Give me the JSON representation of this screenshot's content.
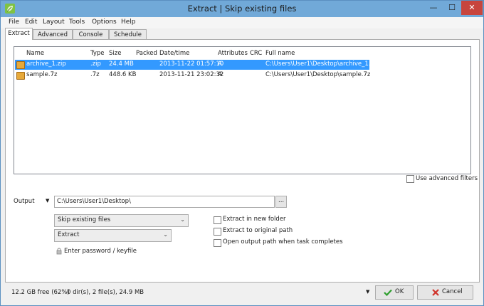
{
  "window": {
    "title": "Extract | Skip existing files",
    "min_glyph": "—",
    "max_glyph": "☐",
    "close_glyph": "✕"
  },
  "menu": [
    "File",
    "Edit",
    "Layout",
    "Tools",
    "Options",
    "Help"
  ],
  "tabs": [
    "Extract",
    "Advanced",
    "Console",
    "Schedule"
  ],
  "active_tab": "Extract",
  "file_list": {
    "columns": [
      "Name",
      "Type",
      "Size",
      "Packed",
      "Date/time",
      "Attributes",
      "CRC",
      "Full name"
    ],
    "rows": [
      {
        "name": "archive_1.zip",
        "type": ".zip",
        "size": "24.4 MB",
        "packed": "",
        "datetime": "2013-11-22 01:57:10",
        "attributes": "A",
        "crc": "",
        "full_name": "C:\\Users\\User1\\Desktop\\archive_1.zip",
        "selected": true
      },
      {
        "name": "sample.7z",
        "type": ".7z",
        "size": "448.6 KB",
        "packed": "",
        "datetime": "2013-11-21 23:02:32",
        "attributes": "A",
        "crc": "",
        "full_name": "C:\\Users\\User1\\Desktop\\sample.7z",
        "selected": false
      }
    ]
  },
  "advanced_filters_label": "Use advanced filters",
  "output": {
    "label": "Output",
    "path": "C:\\Users\\User1\\Desktop\\",
    "browse_label": "...",
    "mode_select": "Skip existing files",
    "action_select": "Extract",
    "password_label": "Enter password / keyfile"
  },
  "options": {
    "new_folder": "Extract in new folder",
    "original_path": "Extract to original path",
    "open_output": "Open output path when task completes"
  },
  "status": {
    "free_space": "12.2 GB free (62%)",
    "summary": "0 dir(s), 2 file(s), 24.9 MB"
  },
  "buttons": {
    "ok": "OK",
    "cancel": "Cancel"
  },
  "colors": {
    "titlebar": "#71a9d8",
    "selection": "#3399ff",
    "close_button": "#c7453d",
    "ok_check": "#2e9e2e",
    "cancel_x": "#d0342c"
  }
}
